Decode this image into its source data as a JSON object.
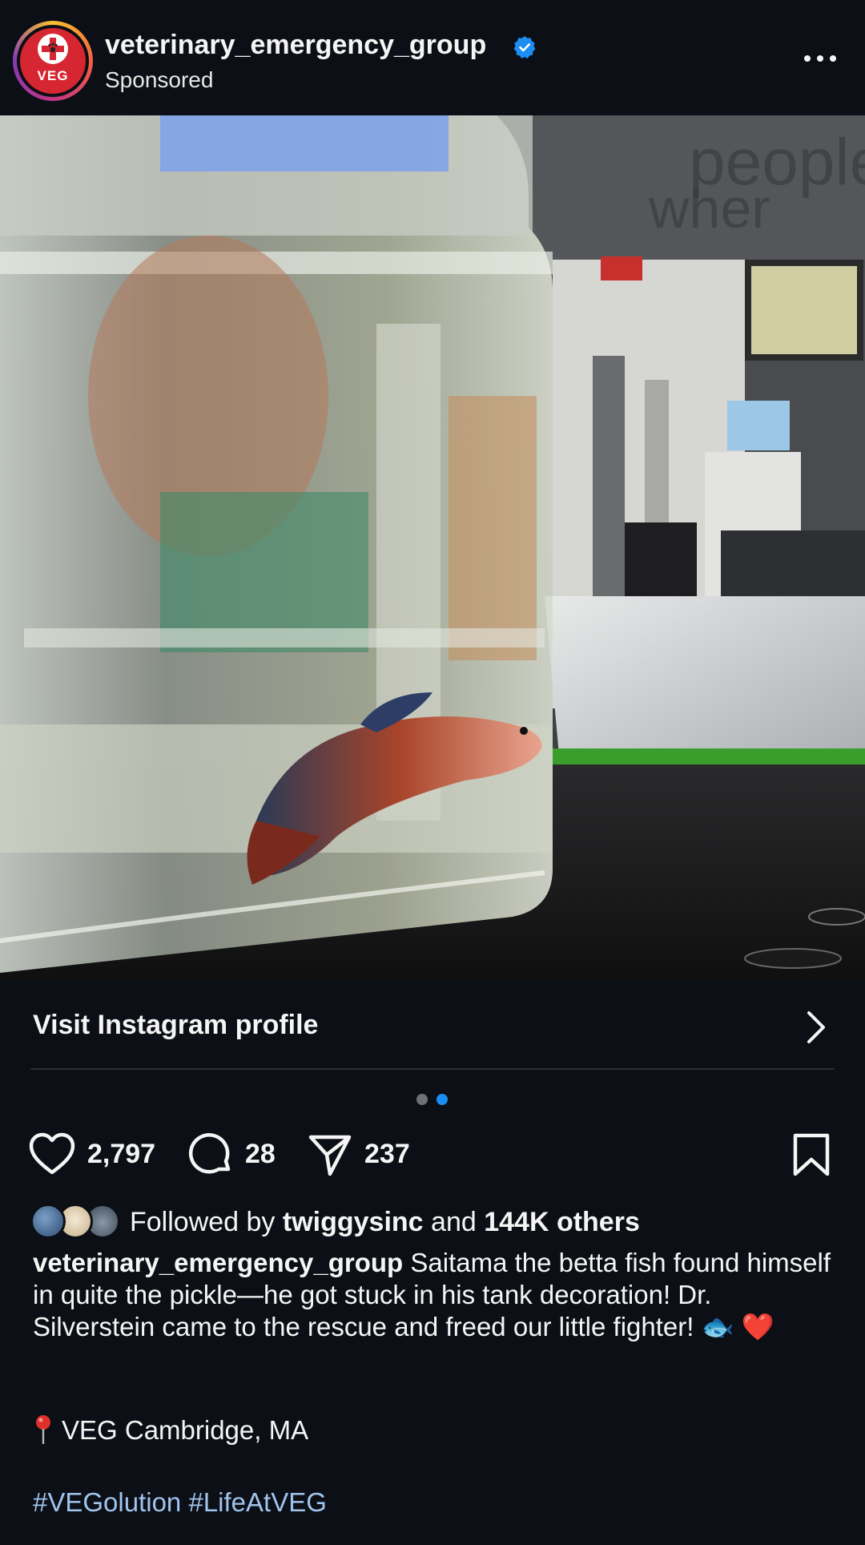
{
  "post": {
    "username": "veterinary_emergency_group",
    "label": "Sponsored",
    "avatar_text": "VEG",
    "verified_color": "#1c8ef2",
    "image_icon": "betta-fish-in-glass-jar-photo"
  },
  "profile_link": {
    "label": "Visit Instagram profile"
  },
  "carousel": {
    "total": 2,
    "active": 2
  },
  "actions": {
    "likes": "2,797",
    "comments": "28",
    "shares": "237"
  },
  "followed_by": {
    "prefix": "Followed by",
    "user": "twiggysinc",
    "and": "and",
    "others": "144K others"
  },
  "caption": {
    "user": "veterinary_emergency_group",
    "text": "Saitama the betta fish found himself in quite the pickle—he got stuck in his tank decoration! Dr. Silverstein came to the rescue and freed our little fighter! 🐟 ❤️"
  },
  "location": "VEG Cambridge, MA",
  "hashtags": "#VEGolution #LifeAtVEG"
}
